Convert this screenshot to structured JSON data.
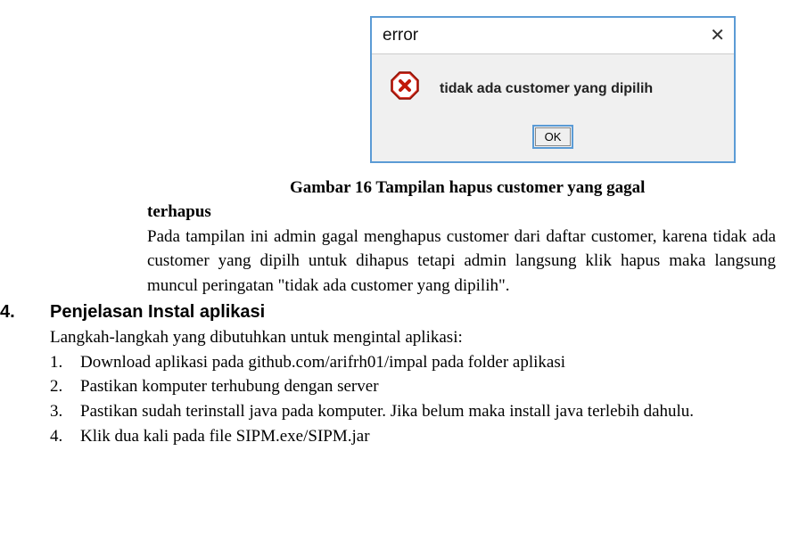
{
  "dialog": {
    "title": "error",
    "close_glyph": "✕",
    "message": "tidak ada customer yang dipilih",
    "ok_label": "OK"
  },
  "caption": {
    "line1": "Gambar 16 Tampilan hapus customer yang gagal",
    "line2": "terhapus"
  },
  "paragraph": "Pada tampilan ini admin gagal menghapus customer dari daftar customer, karena tidak ada customer yang dipilh untuk dihapus tetapi admin langsung klik hapus maka langsung muncul peringatan \"tidak ada customer yang dipilih\".",
  "section4": {
    "number": "4.",
    "title": "Penjelasan Instal aplikasi",
    "intro": "Langkah-langkah yang dibutuhkan untuk mengintal aplikasi:",
    "steps": [
      {
        "num": "1.",
        "text": "Download aplikasi pada github.com/arifrh01/impal pada folder aplikasi"
      },
      {
        "num": "2.",
        "text": "Pastikan komputer terhubung dengan server"
      },
      {
        "num": "3.",
        "text": "Pastikan sudah terinstall java pada komputer. Jika belum maka install java terlebih dahulu."
      },
      {
        "num": "4.",
        "text": "Klik dua kali pada file SIPM.exe/SIPM.jar"
      }
    ]
  }
}
